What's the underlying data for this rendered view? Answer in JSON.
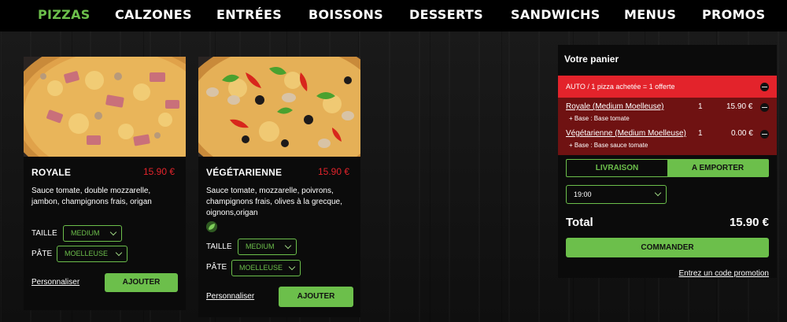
{
  "nav": {
    "items": [
      "PIZZAS",
      "CALZONES",
      "ENTRÉES",
      "BOISSONS",
      "DESSERTS",
      "SANDWICHS",
      "MENUS",
      "PROMOS"
    ]
  },
  "colors": {
    "accent": "#6cbf4b",
    "price": "#e3232b",
    "promo": "#e3232b",
    "cart_lines": "#6f1212"
  },
  "products": [
    {
      "name": "ROYALE",
      "price": "15.90 €",
      "description": "Sauce tomate, double mozzarelle, jambon, champignons frais, origan",
      "size_label": "TAILLE",
      "size_value": "MEDIUM",
      "crust_label": "PÂTE",
      "crust_value": "MOELLEUSE",
      "customize_label": "Personnaliser",
      "add_label": "AJOUTER"
    },
    {
      "name": "VÉGÉTARIENNE",
      "price": "15.90 €",
      "description": "Sauce tomate, mozzarelle, poivrons, champignons frais, olives à la grecque, oignons,origan",
      "size_label": "TAILLE",
      "size_value": "MEDIUM",
      "crust_label": "PÂTE",
      "crust_value": "MOELLEUSE",
      "customize_label": "Personnaliser",
      "add_label": "AJOUTER",
      "badge_icon": "leaf-icon"
    }
  ],
  "cart": {
    "title": "Votre panier",
    "promo_text": "AUTO / 1 pizza achetée = 1 offerte",
    "lines": [
      {
        "name": "Royale (Medium Moelleuse)",
        "qty": "1",
        "price": "15.90 €",
        "detail": "+ Base : Base tomate"
      },
      {
        "name": "Végétarienne (Medium Moelleuse)",
        "qty": "1",
        "price": "0.00 €",
        "detail": "+ Base : Base sauce tomate"
      }
    ],
    "delivery_label": "LIVRAISON",
    "takeaway_label": "A EMPORTER",
    "time_value": "19:00",
    "total_label": "Total",
    "total_value": "15.90 €",
    "order_label": "COMMANDER",
    "promo_code_label": "Entrez un code promotion"
  }
}
